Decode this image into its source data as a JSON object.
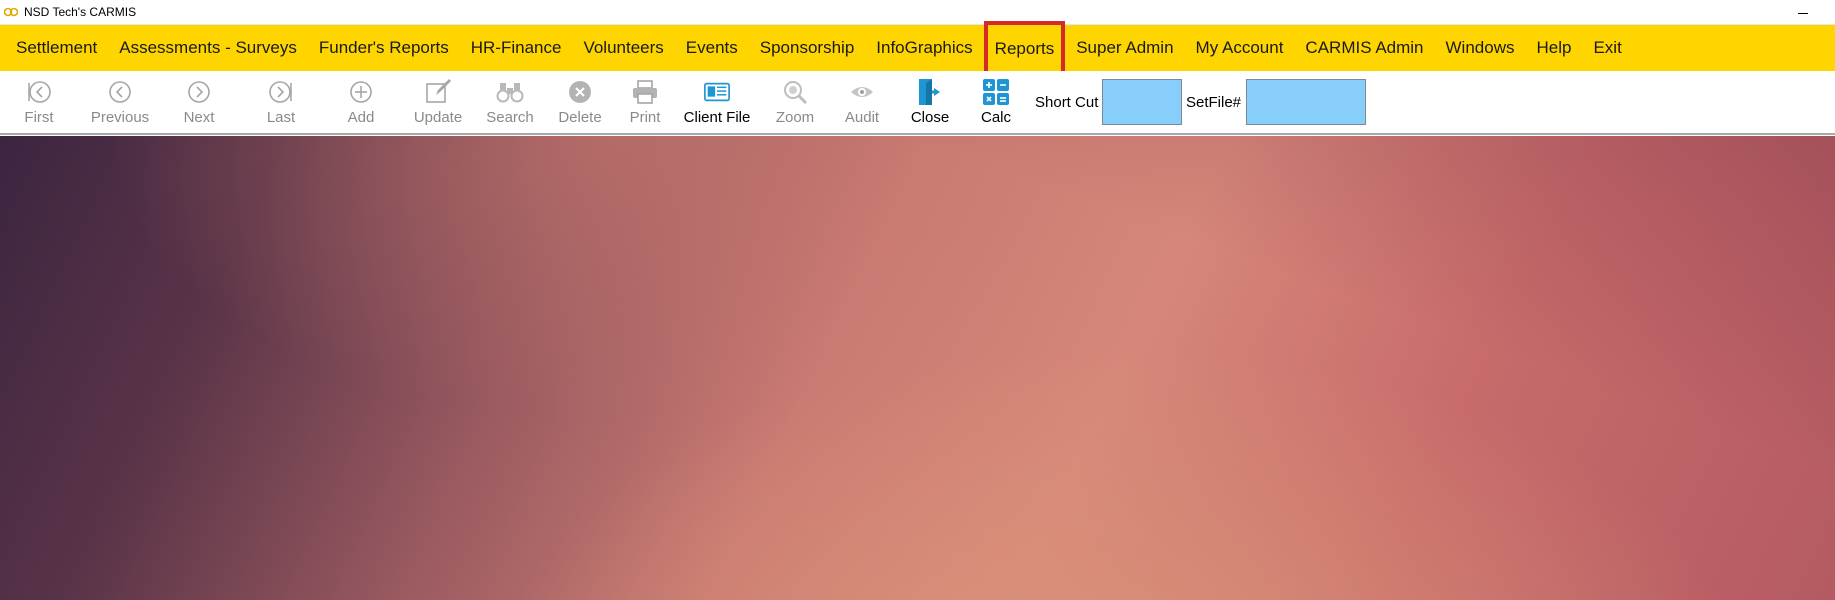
{
  "window": {
    "title": "NSD Tech's CARMIS",
    "minimize_label": "Minimize"
  },
  "menu": {
    "items": [
      {
        "label": "Settlement"
      },
      {
        "label": "Assessments - Surveys"
      },
      {
        "label": "Funder's Reports"
      },
      {
        "label": "HR-Finance"
      },
      {
        "label": "Volunteers"
      },
      {
        "label": "Events"
      },
      {
        "label": "Sponsorship"
      },
      {
        "label": "InfoGraphics"
      },
      {
        "label": "Reports",
        "highlighted": true
      },
      {
        "label": "Super Admin"
      },
      {
        "label": "My Account"
      },
      {
        "label": "CARMIS Admin"
      },
      {
        "label": "Windows"
      },
      {
        "label": "Help"
      },
      {
        "label": "Exit"
      }
    ]
  },
  "toolbar": {
    "buttons": [
      {
        "label": "First",
        "icon": "first-icon",
        "enabled": false
      },
      {
        "label": "Previous",
        "icon": "previous-icon",
        "enabled": false
      },
      {
        "label": "Next",
        "icon": "next-icon",
        "enabled": false
      },
      {
        "label": "Last",
        "icon": "last-icon",
        "enabled": false
      },
      {
        "label": "Add",
        "icon": "add-icon",
        "enabled": false
      },
      {
        "label": "Update",
        "icon": "edit-icon",
        "enabled": false
      },
      {
        "label": "Search",
        "icon": "binoculars-icon",
        "enabled": false
      },
      {
        "label": "Delete",
        "icon": "delete-icon",
        "enabled": false
      },
      {
        "label": "Print",
        "icon": "printer-icon",
        "enabled": false
      },
      {
        "label": "Client File",
        "icon": "client-file-icon",
        "enabled": true
      },
      {
        "label": "Zoom",
        "icon": "zoom-icon",
        "enabled": false
      },
      {
        "label": "Audit",
        "icon": "eye-icon",
        "enabled": false
      },
      {
        "label": "Close",
        "icon": "exit-door-icon",
        "enabled": true
      },
      {
        "label": "Calc",
        "icon": "calculator-icon",
        "enabled": true
      }
    ],
    "shortcut_label": "Short Cut",
    "shortcut_value": "",
    "setfile_label": "SetFile#",
    "setfile_value": ""
  },
  "colors": {
    "menubar": "#ffd500",
    "highlight": "#d42a2a",
    "input_bg": "#87cefa",
    "icon_blue": "#1e96d4",
    "icon_gray": "#a6a6a6"
  }
}
